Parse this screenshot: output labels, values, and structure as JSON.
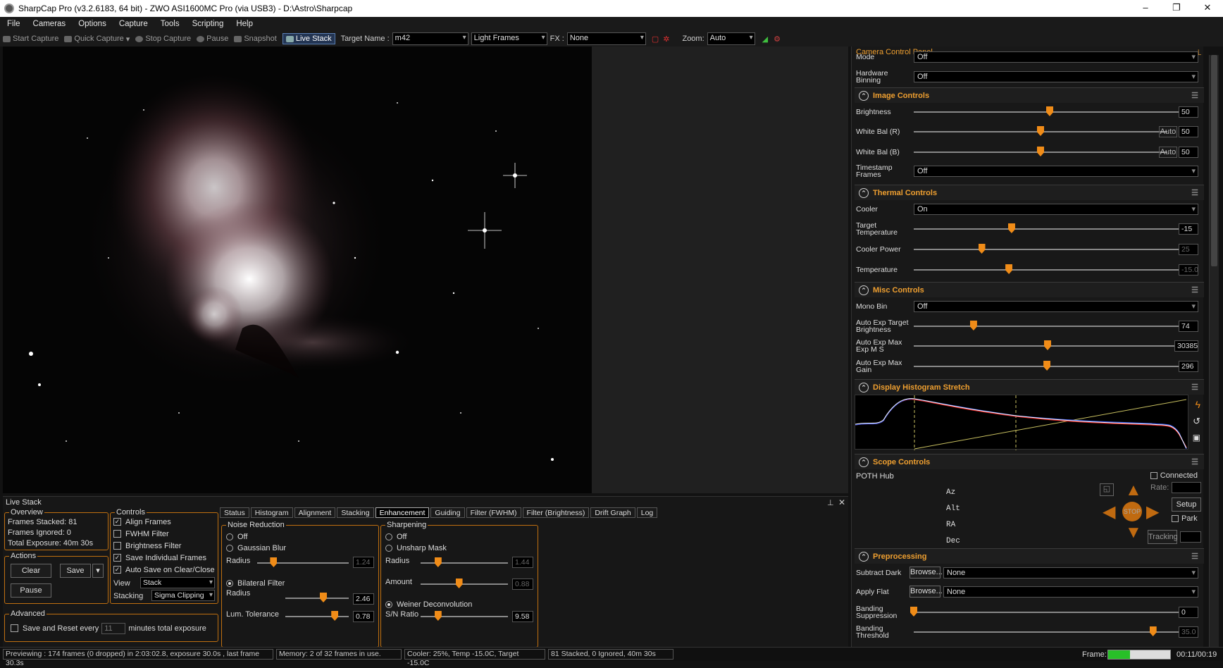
{
  "window": {
    "title": "SharpCap Pro (v3.2.6183, 64 bit) - ZWO ASI1600MC Pro (via USB3) - D:\\Astro\\Sharpcap",
    "min": "–",
    "max": "❐",
    "close": "✕"
  },
  "menu": [
    "File",
    "Cameras",
    "Options",
    "Capture",
    "Tools",
    "Scripting",
    "Help"
  ],
  "toolbar": {
    "start": "Start Capture",
    "quick": "Quick Capture",
    "stop": "Stop Capture",
    "pause": "Pause",
    "snapshot": "Snapshot",
    "livestack": "Live Stack",
    "target_label": "Target Name :",
    "target_value": "m42",
    "frames_value": "Light Frames",
    "fx_label": "FX :",
    "fx_value": "None",
    "zoom_label": "Zoom:",
    "zoom_value": "Auto"
  },
  "cpanel": {
    "title": "Camera Control Panel",
    "mode_label": "Mode",
    "mode_value": "Off",
    "binning_label": "Hardware Binning",
    "binning_value": "Off",
    "image_controls": {
      "title": "Image Controls",
      "brightness_label": "Brightness",
      "brightness": "50",
      "brightness_frac": 0.5,
      "wbr_label": "White Bal (R)",
      "wbr": "50",
      "wbr_frac": 0.5,
      "wbb_label": "White Bal (B)",
      "wbb": "50",
      "wbb_frac": 0.5,
      "auto": "Auto",
      "timestamp_label": "Timestamp Frames",
      "timestamp_value": "Off"
    },
    "thermal": {
      "title": "Thermal Controls",
      "cooler_label": "Cooler",
      "cooler_value": "On",
      "target_label": "Target Temperature",
      "target": "-15",
      "target_frac": 0.36,
      "power_label": "Cooler Power",
      "power": "25",
      "power_frac": 0.25,
      "temp_label": "Temperature",
      "temp": "-15.0",
      "temp_frac": 0.35
    },
    "misc": {
      "title": "Misc Controls",
      "mono_label": "Mono Bin",
      "mono_value": "Off",
      "aet_label": "Auto Exp Target Brightness",
      "aet": "74",
      "aet_frac": 0.22,
      "aem_label": "Auto Exp Max Exp M S",
      "aem": "30385",
      "aem_frac": 0.5,
      "aeg_label": "Auto Exp Max Gain",
      "aeg": "296",
      "aeg_frac": 0.49
    },
    "histogram": {
      "title": "Display Histogram Stretch"
    },
    "scope": {
      "title": "Scope Controls",
      "hub": "POTH Hub",
      "connected": "Connected",
      "az": "Az",
      "alt": "Alt",
      "ra": "RA",
      "dec": "Dec",
      "rate": "Rate:",
      "setup": "Setup",
      "park": "Park",
      "tracking": "Tracking",
      "stop": "STOP"
    },
    "preproc": {
      "title": "Preprocessing",
      "dark_label": "Subtract Dark",
      "flat_label": "Apply Flat",
      "browse": "Browse...",
      "none": "None",
      "band_sup_label": "Banding Suppression",
      "band_sup": "0",
      "band_sup_frac": 0.0,
      "band_thr_label": "Banding Threshold",
      "band_thr": "35.0",
      "band_thr_frac": 0.88
    }
  },
  "livestack": {
    "title": "Live Stack",
    "overview": {
      "title": "Overview",
      "stacked": "Frames Stacked:  81",
      "ignored": "Frames Ignored:  0",
      "exposure": "Total Exposure:   40m 30s"
    },
    "controls": {
      "title": "Controls",
      "align": "Align Frames",
      "fwhm": "FWHM Filter",
      "bright": "Brightness Filter",
      "save_ind": "Save Individual Frames",
      "autosave": "Auto Save on Clear/Close",
      "view_label": "View",
      "view_value": "Stack",
      "stacking_label": "Stacking",
      "stacking_value": "Sigma Clipping"
    },
    "actions": {
      "title": "Actions",
      "clear": "Clear",
      "save": "Save",
      "pause": "Pause"
    },
    "advanced": {
      "title": "Advanced",
      "save_reset": "Save and Reset every",
      "minutes_value": "11",
      "minutes_label": "minutes total exposure"
    },
    "tabs": [
      "Status",
      "Histogram",
      "Alignment",
      "Stacking",
      "Enhancement",
      "Guiding",
      "Filter (FWHM)",
      "Filter (Brightness)",
      "Drift Graph",
      "Log"
    ],
    "noise": {
      "title": "Noise Reduction",
      "off": "Off",
      "gauss": "Gaussian Blur",
      "radius_label": "Radius",
      "radius": "1.24",
      "radius_frac": 0.18,
      "bilateral": "Bilateral Filter",
      "b_radius_label": "Radius",
      "b_radius": "2.46",
      "b_radius_frac": 0.6,
      "lum_label": "Lum. Tolerance",
      "lum": "0.78",
      "lum_frac": 0.78
    },
    "sharpen": {
      "title": "Sharpening",
      "off": "Off",
      "unsharp": "Unsharp Mask",
      "radius_label": "Radius",
      "radius": "1.44",
      "radius_frac": 0.2,
      "amount_label": "Amount",
      "amount": "0.88",
      "amount_frac": 0.44,
      "weiner": "Weiner Deconvolution",
      "sn_label": "S/N Ratio",
      "sn": "9.58",
      "sn_frac": 0.2
    }
  },
  "status": {
    "preview": "Previewing : 174 frames (0 dropped) in 2:03:02.8, exposure 30.0s , last frame 30.3s",
    "memory": "Memory: 2 of 32 frames in use.",
    "cooler": "Cooler: 25%, Temp -15.0C, Target -15.0C",
    "stacked": "81 Stacked, 0 Ignored, 40m 30s",
    "frame_label": "Frame:",
    "frame_progress": 0.35,
    "timer": "00:11/00:19"
  }
}
